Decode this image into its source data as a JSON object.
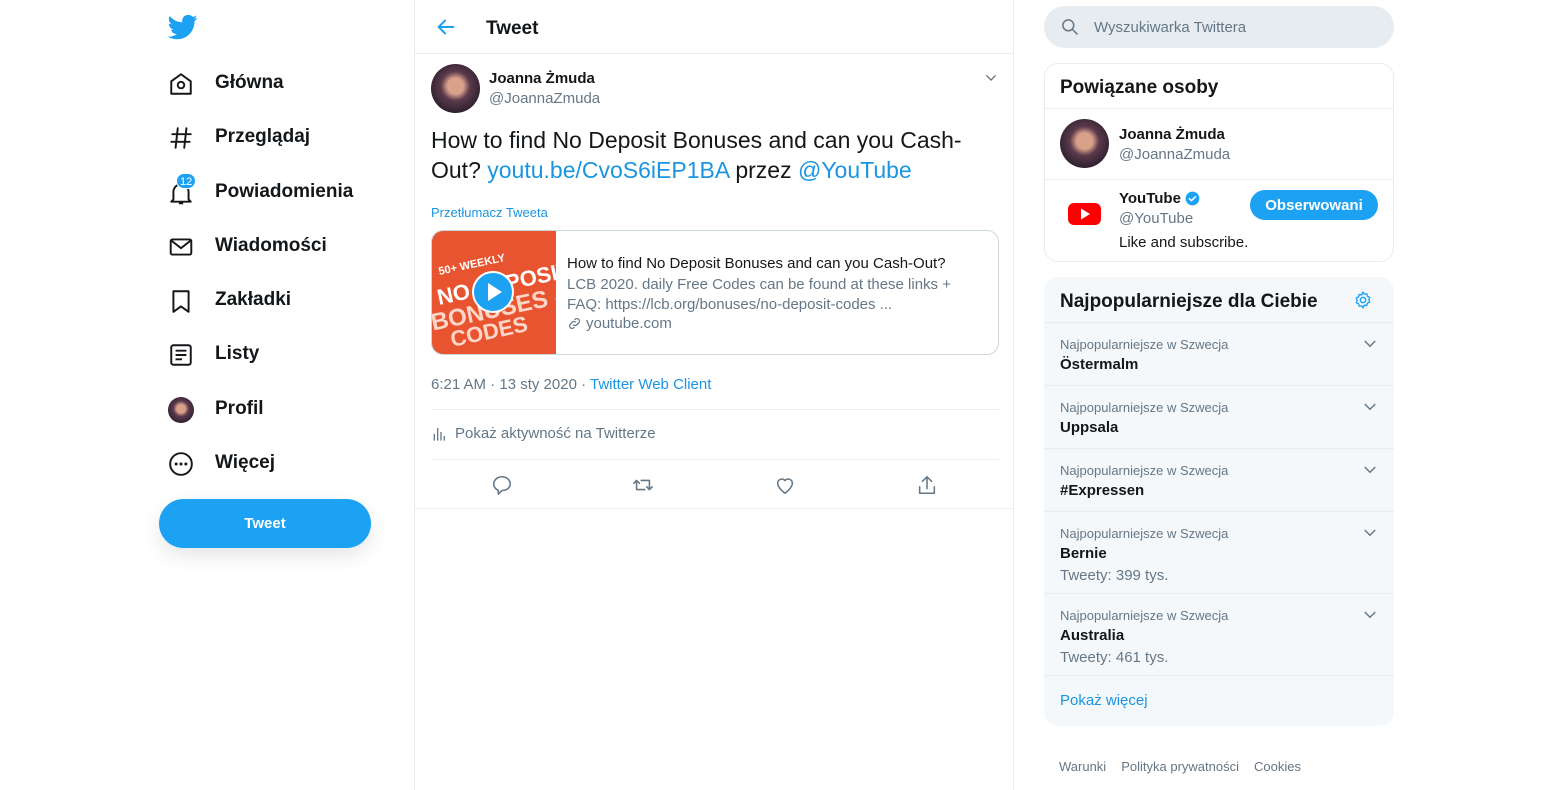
{
  "nav": {
    "items": [
      {
        "label": "Główna",
        "icon": "home-icon"
      },
      {
        "label": "Przeglądaj",
        "icon": "hashtag-icon"
      },
      {
        "label": "Powiadomienia",
        "icon": "bell-icon",
        "badge": "12"
      },
      {
        "label": "Wiadomości",
        "icon": "mail-icon"
      },
      {
        "label": "Zakładki",
        "icon": "bookmark-icon"
      },
      {
        "label": "Listy",
        "icon": "list-icon"
      },
      {
        "label": "Profil",
        "icon": "avatar"
      },
      {
        "label": "Więcej",
        "icon": "more-icon"
      }
    ],
    "tweet_button": "Tweet"
  },
  "header": {
    "title": "Tweet"
  },
  "tweet": {
    "author_name": "Joanna Żmuda",
    "author_handle": "@JoannaZmuda",
    "text_before": "How to find No Deposit Bonuses and can you Cash-Out? ",
    "link": "youtu.be/CvoS6iEP1BA",
    "text_middle": " przez ",
    "mention": "@YouTube",
    "translate": "Przetłumacz Tweeta",
    "card": {
      "thumb_line1": "50+ WEEKLY",
      "thumb_line2": "NO DEPOSIT",
      "thumb_line3": "BONUSES &",
      "thumb_line4": "CODES",
      "title": "How to find No Deposit Bonuses and can you Cash-Out?",
      "description": "LCB 2020. daily Free Codes can be found at these links + FAQ: https://lcb.org/bonuses/no-deposit-codes ...",
      "domain": "youtube.com"
    },
    "time": "6:21 AM · 13 sty 2020 · ",
    "client": "Twitter Web Client",
    "activity": "Pokaż aktywność na Twitterze"
  },
  "search": {
    "placeholder": "Wyszukiwarka Twittera"
  },
  "related": {
    "title": "Powiązane osoby",
    "people": [
      {
        "name": "Joanna Żmuda",
        "handle": "@JoannaZmuda"
      },
      {
        "name": "YouTube",
        "handle": "@YouTube",
        "bio": "Like and subscribe.",
        "button": "Obserwowani"
      }
    ]
  },
  "trends": {
    "title": "Najpopularniejsze dla Ciebie",
    "items": [
      {
        "context": "Najpopularniejsze w Szwecja",
        "name": "Östermalm",
        "count": ""
      },
      {
        "context": "Najpopularniejsze w Szwecja",
        "name": "Uppsala",
        "count": ""
      },
      {
        "context": "Najpopularniejsze w Szwecja",
        "name": "#Expressen",
        "count": ""
      },
      {
        "context": "Najpopularniejsze w Szwecja",
        "name": "Bernie",
        "count": "Tweety: 399 tys."
      },
      {
        "context": "Najpopularniejsze w Szwecja",
        "name": "Australia",
        "count": "Tweety: 461 tys."
      }
    ],
    "show_more": "Pokaż więcej"
  },
  "footer": {
    "links": [
      "Warunki",
      "Polityka prywatności",
      "Cookies"
    ]
  },
  "colors": {
    "accent": "#1da1f2",
    "link": "#1b95e0",
    "secondary_text": "#657786",
    "youtube_red": "#ff0000"
  }
}
